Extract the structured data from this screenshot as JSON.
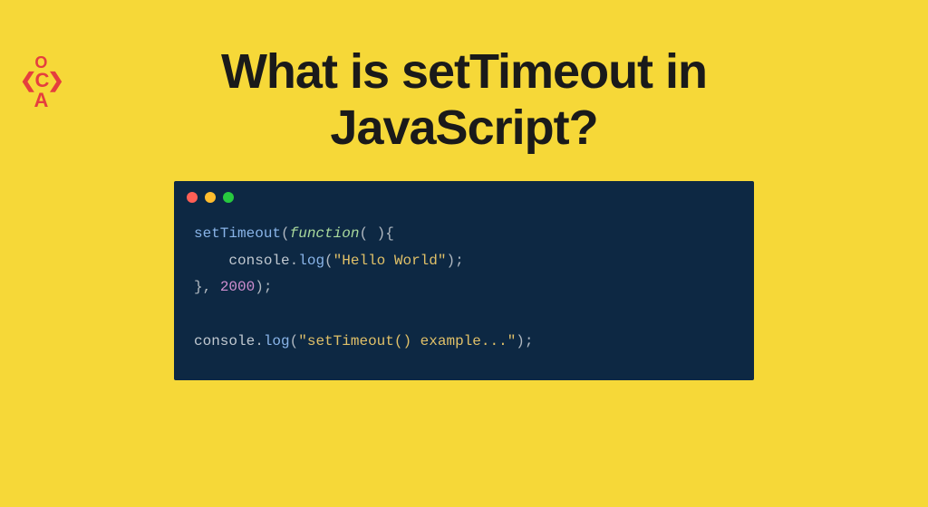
{
  "logo": {
    "top": "O",
    "mid_left": "❮",
    "mid_c": "C",
    "mid_right": "❯",
    "bot": "A"
  },
  "title_line1": "What is setTimeout in",
  "title_line2": "JavaScript?",
  "code": {
    "l1_fn": "setTimeout",
    "l1_po": "(",
    "l1_kw": "function",
    "l1_args": "( )",
    "l1_brace": "{",
    "l2_pad": "    ",
    "l2_obj": "console",
    "l2_dot": ".",
    "l2_method": "log",
    "l2_po": "(",
    "l2_str": "\"Hello World\"",
    "l2_pc": ")",
    "l2_semi": ";",
    "l3_brace": "}",
    "l3_comma": ", ",
    "l3_num": "2000",
    "l3_pc": ")",
    "l3_semi": ";",
    "l5_obj": "console",
    "l5_dot": ".",
    "l5_method": "log",
    "l5_po": "(",
    "l5_str": "\"setTimeout() example...\"",
    "l5_pc": ")",
    "l5_semi": ";"
  }
}
